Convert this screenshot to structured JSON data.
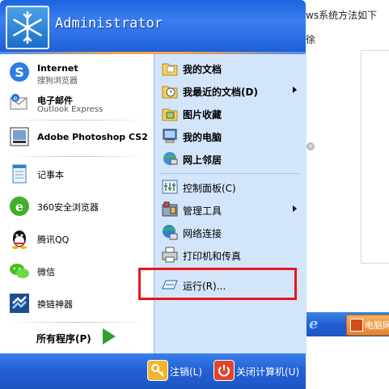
{
  "background": {
    "text_line1": "ws系统方法如下",
    "text_line2": "徐",
    "close_glyph": "×",
    "taskbar_item_label": "电脑网"
  },
  "header": {
    "user_name": "Administrator"
  },
  "left_pinned": [
    {
      "title": "Internet",
      "subtitle": "搜狗浏览器",
      "icon": "sogou-browser-icon"
    },
    {
      "title": "电子邮件",
      "subtitle": "Outlook Express",
      "icon": "outlook-icon"
    }
  ],
  "left_recent": [
    {
      "label": "Adobe Photoshop CS2",
      "icon": "photoshop-icon",
      "bold": true
    },
    {
      "label": "记事本",
      "icon": "notepad-icon"
    },
    {
      "label": "360安全浏览器",
      "icon": "360-browser-icon"
    },
    {
      "label": "腾讯QQ",
      "icon": "qq-icon"
    },
    {
      "label": "微信",
      "icon": "wechat-icon"
    },
    {
      "label": "换链神器",
      "icon": "link-tool-icon"
    }
  ],
  "all_programs": {
    "label": "所有程序(P)"
  },
  "right_items": [
    {
      "label": "我的文档",
      "icon": "my-documents-icon",
      "bold": true,
      "submenu": false
    },
    {
      "label": "我最近的文档(D)",
      "icon": "recent-documents-icon",
      "bold": true,
      "submenu": true
    },
    {
      "label": "图片收藏",
      "icon": "my-pictures-icon",
      "bold": true,
      "submenu": false
    },
    {
      "label": "我的电脑",
      "icon": "my-computer-icon",
      "bold": true,
      "submenu": false
    },
    {
      "label": "网上邻居",
      "icon": "network-places-icon",
      "bold": true,
      "submenu": false
    },
    {
      "label": "控制面板(C)",
      "icon": "control-panel-icon",
      "bold": false,
      "submenu": false
    },
    {
      "label": "管理工具",
      "icon": "admin-tools-icon",
      "bold": false,
      "submenu": true
    },
    {
      "label": "网络连接",
      "icon": "network-connections-icon",
      "bold": false,
      "submenu": false
    },
    {
      "label": "打印机和传真",
      "icon": "printers-icon",
      "bold": false,
      "submenu": false
    },
    {
      "label": "运行(R)...",
      "icon": "run-icon",
      "bold": false,
      "submenu": false
    }
  ],
  "footer": {
    "logoff_label": "注销(L)",
    "shutdown_label": "关闭计算机(U)"
  },
  "colors": {
    "highlight_border": "#e8161b",
    "menu_blue": "#2461d6",
    "right_pane": "#d3e5fa"
  }
}
